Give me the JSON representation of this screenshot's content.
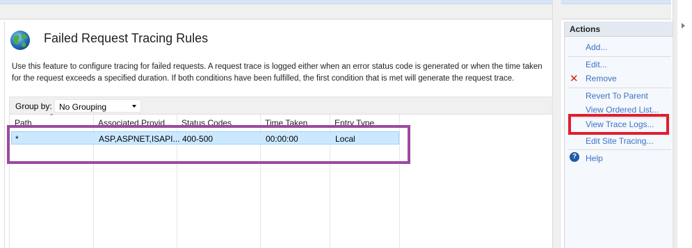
{
  "page": {
    "title": "Failed Request Tracing Rules",
    "description": "Use this feature to configure tracing for failed requests. A request trace is logged either when an error status code is generated or when the time taken for the request exceeds a specified duration. If both conditions have been fulfilled, the first condition that is met will generate the request trace."
  },
  "group_by": {
    "label": "Group by:",
    "value": "No Grouping"
  },
  "table": {
    "columns": [
      "Path",
      "Associated Provid...",
      "Status Codes",
      "Time Taken",
      "Entry Type"
    ],
    "rows": [
      [
        "*",
        "ASP,ASPNET,ISAPI...",
        "400-500",
        "00:00:00",
        "Local"
      ]
    ]
  },
  "actions": {
    "header": "Actions",
    "items": [
      {
        "label": "Add..."
      },
      {
        "label": "Edit..."
      },
      {
        "label": "Remove"
      },
      {
        "label": "Revert To Parent"
      },
      {
        "label": "View Ordered List..."
      },
      {
        "label": "View Trace Logs..."
      },
      {
        "label": "Edit Site Tracing..."
      },
      {
        "label": "Help"
      }
    ]
  },
  "colors": {
    "selected_row": "#cce8ff",
    "link": "#3b71c7",
    "highlight_purple": "#9b4a9e",
    "highlight_red": "#e01e2e"
  },
  "icons": {
    "feature": "globe-icon",
    "remove": "red-x-icon",
    "help": "help-icon"
  }
}
